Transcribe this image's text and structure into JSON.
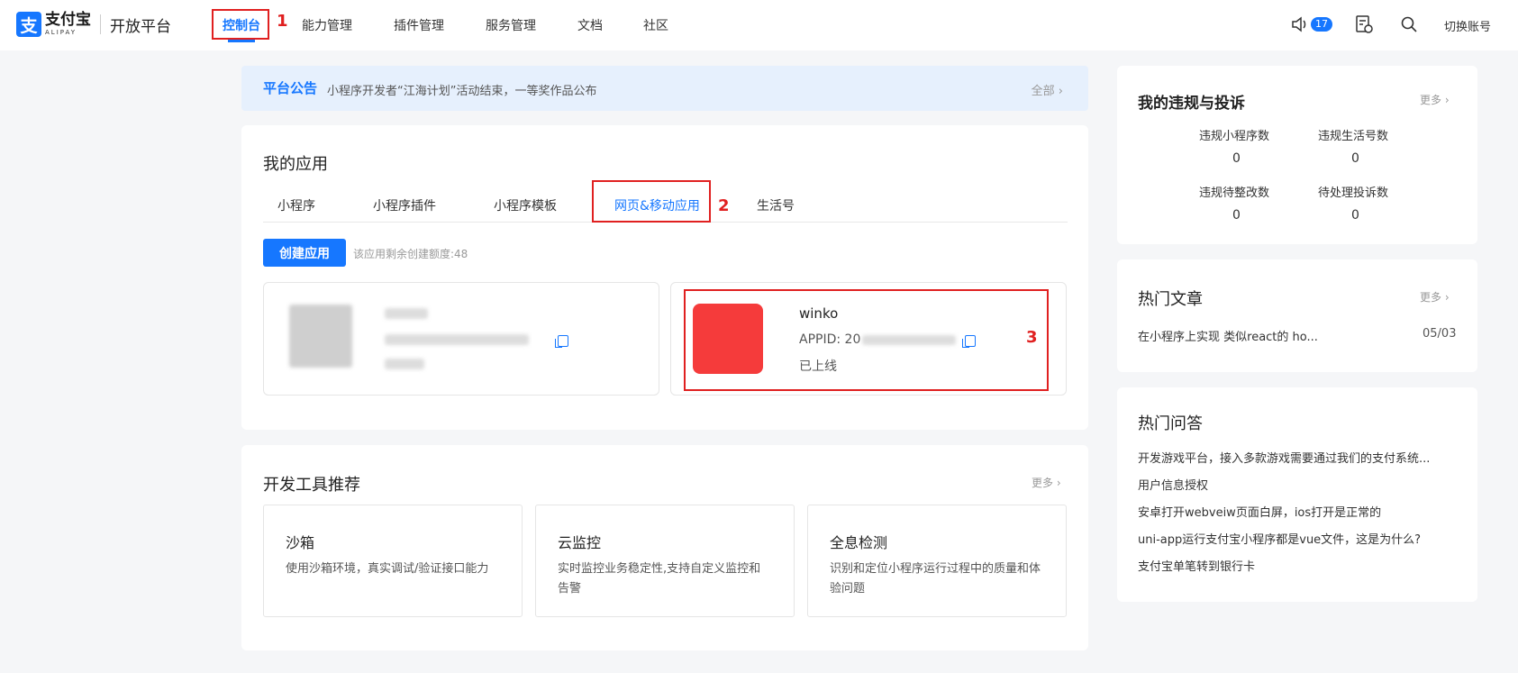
{
  "header": {
    "logo_cn": "支付宝",
    "logo_en": "ALIPAY",
    "logo_sub": "开放平台",
    "nav": [
      "控制台",
      "能力管理",
      "插件管理",
      "服务管理",
      "文档",
      "社区"
    ],
    "notification_count": "17",
    "switch_account": "切换账号"
  },
  "annotations": [
    "1",
    "2",
    "3"
  ],
  "notice": {
    "title": "平台公告",
    "text": "小程序开发者“江海计划”活动结束，一等奖作品公布",
    "more": "全部"
  },
  "apps": {
    "title": "我的应用",
    "tabs": [
      "小程序",
      "小程序插件",
      "小程序模板",
      "网页&移动应用",
      "生活号"
    ],
    "active_tab": 3,
    "create_button": "创建应用",
    "quota": "该应用剩余创建额度:48",
    "card2": {
      "name": "winko",
      "appid": "APPID: 20",
      "status": "已上线"
    }
  },
  "tools": {
    "title": "开发工具推荐",
    "more": "更多",
    "items": [
      {
        "title": "沙箱",
        "desc": "使用沙箱环境，真实调试/验证接口能力"
      },
      {
        "title": "云监控",
        "desc": "实时监控业务稳定性,支持自定义监控和告警"
      },
      {
        "title": "全息检测",
        "desc": "识别和定位小程序运行过程中的质量和体验问题"
      }
    ]
  },
  "violations": {
    "title": "我的违规与投诉",
    "more": "更多",
    "stats": [
      {
        "label": "违规小程序数",
        "value": "0"
      },
      {
        "label": "违规生活号数",
        "value": "0"
      },
      {
        "label": "违规待整改数",
        "value": "0"
      },
      {
        "label": "待处理投诉数",
        "value": "0"
      }
    ]
  },
  "hot_articles": {
    "title": "热门文章",
    "more": "更多",
    "items": [
      {
        "title": "在小程序上实现 类似react的 ho...",
        "date": "05/03"
      }
    ]
  },
  "hot_qa": {
    "title": "热门问答",
    "items": [
      "开发游戏平台，接入多款游戏需要通过我们的支付系统...",
      "用户信息授权",
      "安卓打开webveiw页面白屏，ios打开是正常的",
      "uni-app运行支付宝小程序都是vue文件，这是为什么?",
      "支付宝单笔转到银行卡"
    ]
  },
  "colors": {
    "brand": "#1677ff",
    "annotation": "#e02020",
    "app_icon": "#f53b3b"
  }
}
